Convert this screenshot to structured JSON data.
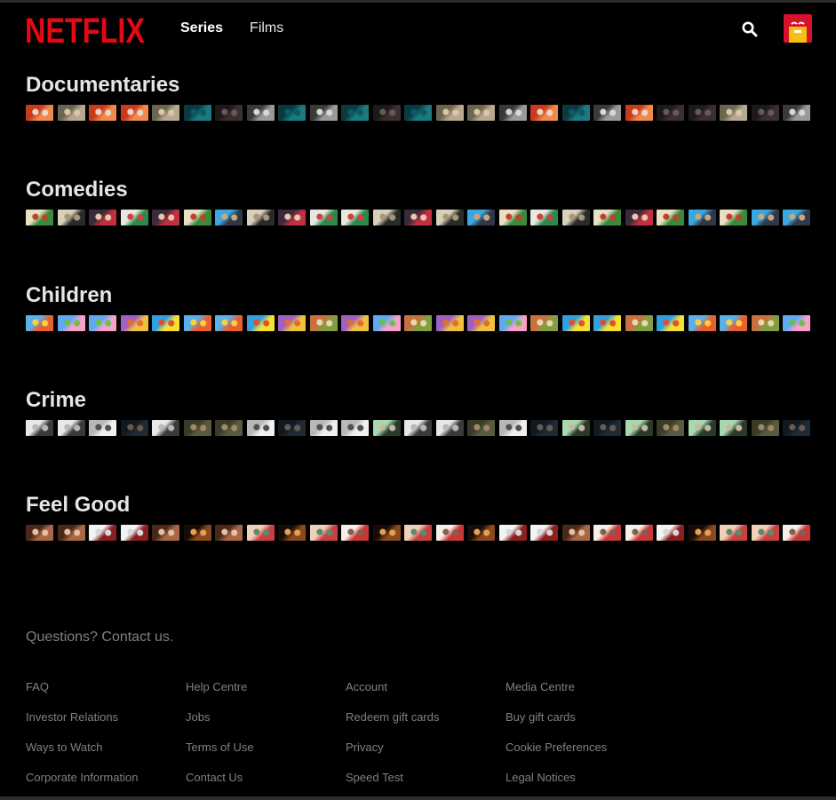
{
  "header": {
    "logo_text": "NETFLIX",
    "nav": [
      {
        "label": "Series",
        "active": true
      },
      {
        "label": "Films",
        "active": false
      }
    ]
  },
  "colors": {
    "brand_red": "#e50914",
    "background": "#000000",
    "footer_text": "#808080"
  },
  "rows": [
    {
      "title": "Documentaries",
      "tiles": [
        "faces-red",
        "faces-beige",
        "faces-red",
        "faces-red",
        "faces-beige",
        "teal",
        "dark-woman",
        "bw-mic",
        "teal",
        "bw-mic",
        "teal",
        "dark-woman",
        "teal",
        "faces-beige",
        "faces-beige",
        "bw-mic",
        "faces-red",
        "teal",
        "bw-mic",
        "faces-red",
        "dark-woman",
        "dark-woman",
        "faces-beige",
        "dark-woman",
        "bw-mic"
      ]
    },
    {
      "title": "Comedies",
      "tiles": [
        "green-field",
        "couple",
        "crowd-red",
        "tropical",
        "crowd-red",
        "green-field",
        "sky-crowd",
        "couple",
        "crowd-red",
        "tropical",
        "tropical",
        "couple",
        "crowd-red",
        "couple",
        "sky-crowd",
        "green-field",
        "tropical",
        "couple",
        "green-field",
        "crowd-red",
        "green-field",
        "sky-crowd",
        "green-field",
        "sky-crowd",
        "sky-crowd"
      ]
    },
    {
      "title": "Children",
      "tiles": [
        "cartoon-bear",
        "pig-blue",
        "pig-blue",
        "explorer",
        "sponge",
        "cartoon-bear",
        "cartoon-bear",
        "sponge",
        "explorer",
        "mushroom",
        "explorer",
        "pig-blue",
        "mushroom",
        "explorer",
        "explorer",
        "pig-blue",
        "mushroom",
        "sponge",
        "sponge",
        "mushroom",
        "sponge",
        "cartoon-bear",
        "cartoon-bear",
        "mushroom",
        "pig-blue"
      ]
    },
    {
      "title": "Crime",
      "tiles": [
        "poster-light",
        "poster-light",
        "white-shirt",
        "dark-man",
        "poster-light",
        "olive-man",
        "olive-man",
        "white-shirt",
        "dark-man",
        "white-shirt",
        "white-shirt",
        "green-group",
        "poster-light",
        "poster-light",
        "olive-man",
        "white-shirt",
        "dark-man",
        "green-group",
        "dark-man",
        "green-group",
        "olive-man",
        "green-group",
        "green-group",
        "olive-man",
        "dark-man"
      ]
    },
    {
      "title": "Feel Good",
      "tiles": [
        "warm-brown",
        "warm-brown",
        "white-table",
        "white-table",
        "warm-brown",
        "candle",
        "warm-brown",
        "pastel-group",
        "candle",
        "pastel-group",
        "festive",
        "candle",
        "pastel-group",
        "festive",
        "candle",
        "white-table",
        "white-table",
        "warm-brown",
        "festive",
        "festive",
        "white-table",
        "candle",
        "pastel-group",
        "pastel-group",
        "festive"
      ]
    }
  ],
  "tile_palettes": {
    "faces-red": [
      "#c83a1e",
      "#f08a4a",
      "#e8d8c8"
    ],
    "faces-beige": [
      "#6a6450",
      "#b8a890",
      "#d8c8a8"
    ],
    "teal": [
      "#0a3a40",
      "#1a7a80",
      "#0d5a60"
    ],
    "dark-woman": [
      "#1a1a1a",
      "#3a3030",
      "#6a5858"
    ],
    "bw-mic": [
      "#3a3a3a",
      "#9a9a9a",
      "#d8d8d8"
    ],
    "green-field": [
      "#e8e0c0",
      "#3a8a3a",
      "#c04030"
    ],
    "couple": [
      "#d8d0b8",
      "#2a2a2a",
      "#a89878"
    ],
    "crowd-red": [
      "#3a2a3a",
      "#c03040",
      "#e8c8b0"
    ],
    "tropical": [
      "#e8e8e0",
      "#2a8a4a",
      "#d04040"
    ],
    "sky-crowd": [
      "#3aa8e0",
      "#303848",
      "#c8a880"
    ],
    "cartoon-bear": [
      "#5ab0e8",
      "#e86030",
      "#f8d040"
    ],
    "pig-blue": [
      "#60a8f0",
      "#f8a0c8",
      "#68c050"
    ],
    "explorer": [
      "#a060c0",
      "#f0c040",
      "#e07030"
    ],
    "sponge": [
      "#30a0e0",
      "#f8e030",
      "#e05030"
    ],
    "mushroom": [
      "#c87040",
      "#80a040",
      "#e8d8b0"
    ],
    "poster-light": [
      "#e8e8e8",
      "#3a3a3a",
      "#b8b8b8"
    ],
    "white-shirt": [
      "#b8b8b8",
      "#f0f0f0",
      "#505050"
    ],
    "dark-man": [
      "#101820",
      "#202a34",
      "#6a5a50"
    ],
    "olive-man": [
      "#3a3a28",
      "#5a5a40",
      "#a08868"
    ],
    "green-group": [
      "#a8d8b0",
      "#2a3a2a",
      "#c8b8a0"
    ],
    "warm-brown": [
      "#4a2818",
      "#a86848",
      "#e8c0a0"
    ],
    "white-table": [
      "#f4f4f4",
      "#8a2020",
      "#d8d8d8"
    ],
    "candle": [
      "#180c08",
      "#8a4a20",
      "#e8a050"
    ],
    "pastel-group": [
      "#f0d0b8",
      "#c84040",
      "#5a8a70"
    ],
    "festive": [
      "#f8f0e8",
      "#c83838",
      "#806050"
    ]
  },
  "footer": {
    "contact": "Questions? Contact us.",
    "links": [
      "FAQ",
      "Help Centre",
      "Account",
      "Media Centre",
      "Investor Relations",
      "Jobs",
      "Redeem gift cards",
      "Buy gift cards",
      "Ways to Watch",
      "Terms of Use",
      "Privacy",
      "Cookie Preferences",
      "Corporate Information",
      "Contact Us",
      "Speed Test",
      "Legal Notices"
    ]
  }
}
